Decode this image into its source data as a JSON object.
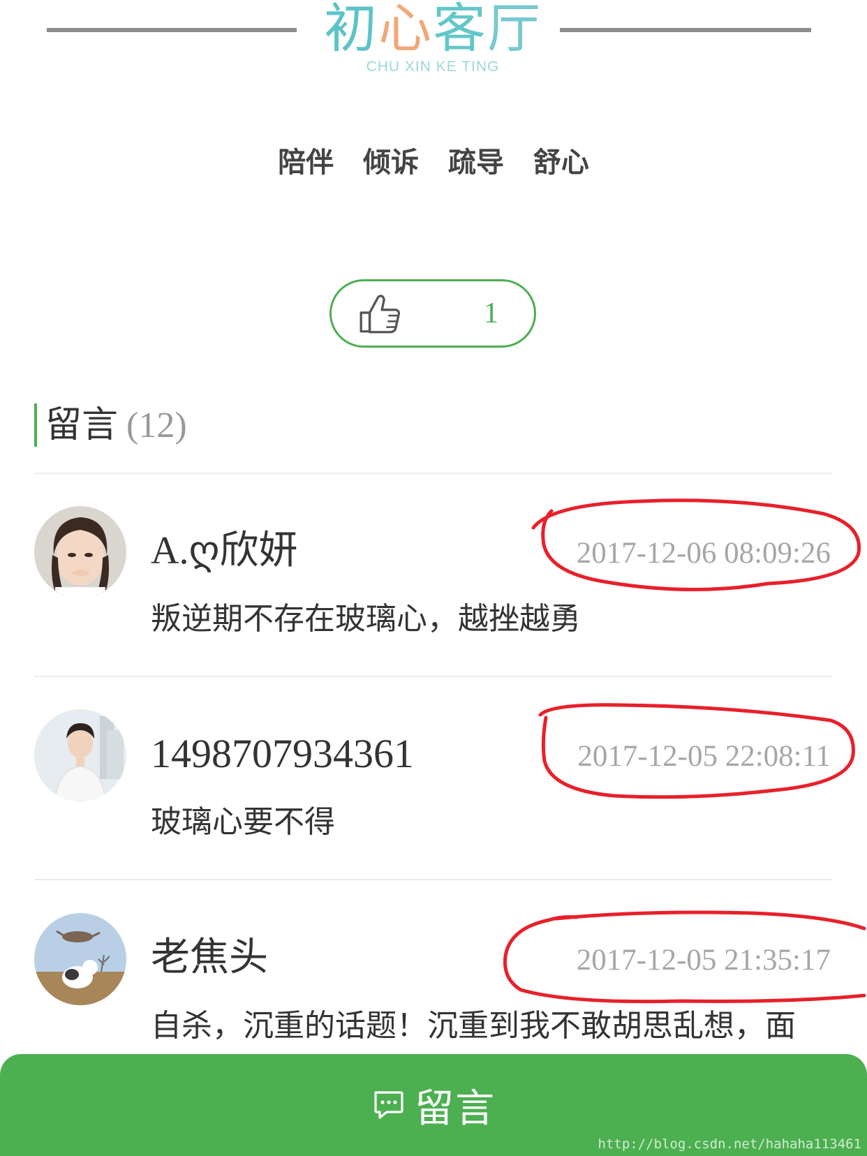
{
  "header": {
    "logo_char_1": "初",
    "logo_char_2": "心",
    "logo_char_3": "客",
    "logo_char_4": "厅",
    "logo_subtitle": "CHU XIN KE TING",
    "tags": [
      "陪伴",
      "倾诉",
      "疏导",
      "舒心"
    ]
  },
  "like": {
    "icon": "thumbs-up-icon",
    "count": "1"
  },
  "comments": {
    "title": "留言",
    "count": "(12)",
    "items": [
      {
        "username": "A.ღ欣妍",
        "timestamp": "2017-12-06 08:09:26",
        "text": "叛逆期不存在玻璃心，越挫越勇"
      },
      {
        "username": "1498707934361",
        "timestamp": "2017-12-05 22:08:11",
        "text": "玻璃心要不得"
      },
      {
        "username": "老焦头",
        "timestamp": "2017-12-05 21:35:17",
        "text": "自杀，沉重的话题！沉重到我不敢胡思乱想，面"
      }
    ]
  },
  "bottom_bar": {
    "icon": "message-icon",
    "label": "留言"
  },
  "watermark": "http://blog.csdn.net/hahaha113461",
  "colors": {
    "accent": "#4caf50",
    "annotation": "#e8202a",
    "logo": "#4fc3c3"
  }
}
